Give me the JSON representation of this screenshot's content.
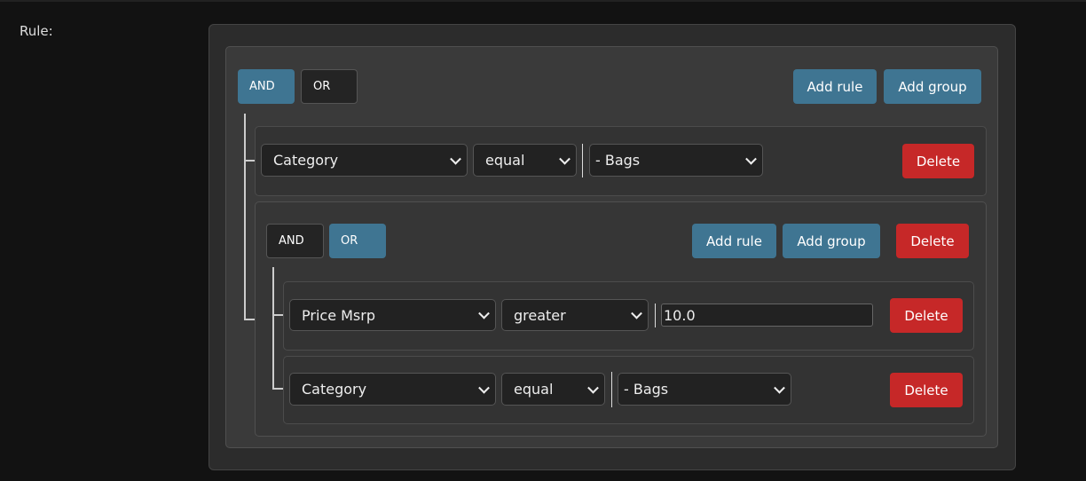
{
  "label": "Rule:",
  "root": {
    "and": "AND",
    "or": "OR",
    "add_rule": "Add rule",
    "add_group": "Add group",
    "rule1": {
      "field": "Category",
      "operator": "equal",
      "value": "- Bags",
      "delete": "Delete"
    },
    "group": {
      "and": "AND",
      "or": "OR",
      "add_rule": "Add rule",
      "add_group": "Add group",
      "delete": "Delete",
      "rule1": {
        "field": "Price Msrp",
        "operator": "greater",
        "value": "10.0",
        "delete": "Delete"
      },
      "rule2": {
        "field": "Category",
        "operator": "equal",
        "value": "- Bags",
        "delete": "Delete"
      }
    }
  }
}
